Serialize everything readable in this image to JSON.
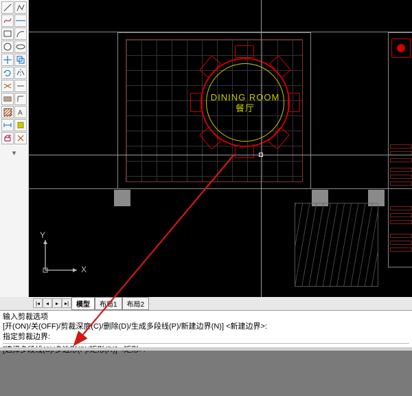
{
  "drawing": {
    "dining_label_en": "DINING ROOM",
    "dining_label_cn": "餐厅",
    "ucs_x": "X",
    "ucs_y": "Y"
  },
  "colors": {
    "accent_red": "#cc0000",
    "accent_yellow": "#cccc00",
    "guide": "#9a9a9a"
  },
  "tabs": {
    "model": "模型",
    "layout1": "布局1",
    "layout2": "布局2"
  },
  "command": {
    "line1": "输入剪裁选项",
    "line2": "[开(ON)/关(OFF)/剪裁深度(C)/删除(D)/生成多段线(P)/新建边界(N)] <新建边界>:",
    "line3": "指定剪裁边界:",
    "line4": "[选择多段线(S)/多边形(P)/矩形(R)] <矩形>:"
  },
  "toolbar": {
    "icons": [
      "line-icon",
      "polyline-icon",
      "spline-icon",
      "xline-icon",
      "rect-icon",
      "arc-icon",
      "circle-icon",
      "ellipse-icon",
      "move-icon",
      "copy-icon",
      "rotate-icon",
      "mirror-icon",
      "trim-icon",
      "extend-icon",
      "offset-icon",
      "fillet-icon",
      "hatch-icon",
      "text-icon",
      "dim-icon",
      "block-icon",
      "erase-icon",
      "explode-icon"
    ]
  }
}
